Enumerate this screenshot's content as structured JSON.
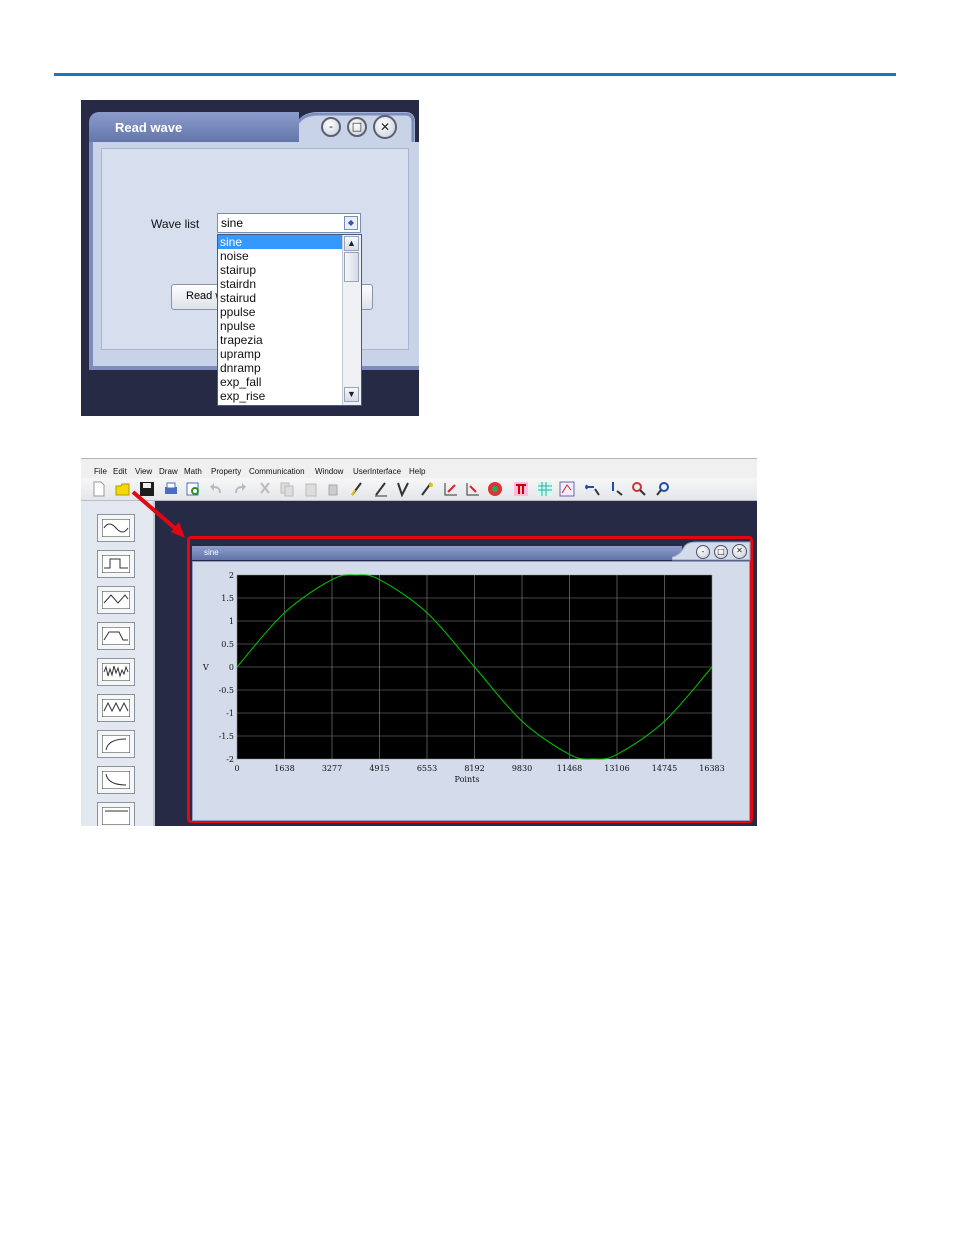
{
  "read_wave_dialog": {
    "title": "Read wave",
    "wave_list_label": "Wave list",
    "selected_value": "sine",
    "read_button_label": "Read w",
    "options": [
      "sine",
      "noise",
      "stairup",
      "stairdn",
      "stairud",
      "ppulse",
      "npulse",
      "trapezia",
      "upramp",
      "dnramp",
      "exp_fall",
      "exp_rise"
    ]
  },
  "app": {
    "menu": [
      "File",
      "Edit",
      "View",
      "Draw",
      "Math",
      "Property",
      "Communication",
      "Window",
      "UserInterface",
      "Help"
    ],
    "toolbar_icons": [
      "new-file-icon",
      "open-folder-icon",
      "save-icon",
      "print-icon",
      "print-preview-icon",
      "undo-icon",
      "redo-icon",
      "cut-icon",
      "copy-icon",
      "paste-icon",
      "delete-icon",
      "pencil-icon",
      "line-icon",
      "vertex-icon",
      "marker-icon",
      "axis-x-icon",
      "axis-scale-icon",
      "color-wheel-icon",
      "filter-icon",
      "grid-icon",
      "fit-icon",
      "zoom-x-icon",
      "zoom-y-icon",
      "zoom-box-icon",
      "zoom-reset-icon"
    ],
    "waveform_palette": [
      "sine-wave-icon",
      "square-wave-icon",
      "triangle-wave-icon",
      "pulse-wave-icon",
      "noise-wave-icon",
      "sawtooth-wave-icon",
      "exp-rise-icon",
      "exp-fall-icon",
      "dc-level-icon"
    ],
    "highlight_color": "#e30613",
    "wave_window_title": "sine"
  },
  "chart_data": {
    "type": "line",
    "title": "",
    "xlabel": "Points",
    "ylabel": "V",
    "xlim": [
      0,
      16383
    ],
    "ylim": [
      -2,
      2
    ],
    "x_ticks": [
      "0",
      "1638",
      "3277",
      "4915",
      "6553",
      "8192",
      "9830",
      "11468",
      "13106",
      "14745",
      "16383"
    ],
    "y_ticks": [
      "2",
      "1.5",
      "1",
      "0.5",
      "0",
      "-0.5",
      "-1",
      "-1.5",
      "-2"
    ],
    "grid": true,
    "background": "#000000",
    "line_color": "#00c800",
    "series": [
      {
        "x": [
          0,
          1638,
          3277,
          4096,
          4915,
          6553,
          8192,
          9830,
          11468,
          12288,
          13106,
          14745,
          16383
        ],
        "values": [
          0,
          1.18,
          1.9,
          2,
          1.9,
          1.18,
          0,
          -1.18,
          -1.9,
          -2,
          -1.9,
          -1.18,
          0
        ]
      }
    ]
  }
}
